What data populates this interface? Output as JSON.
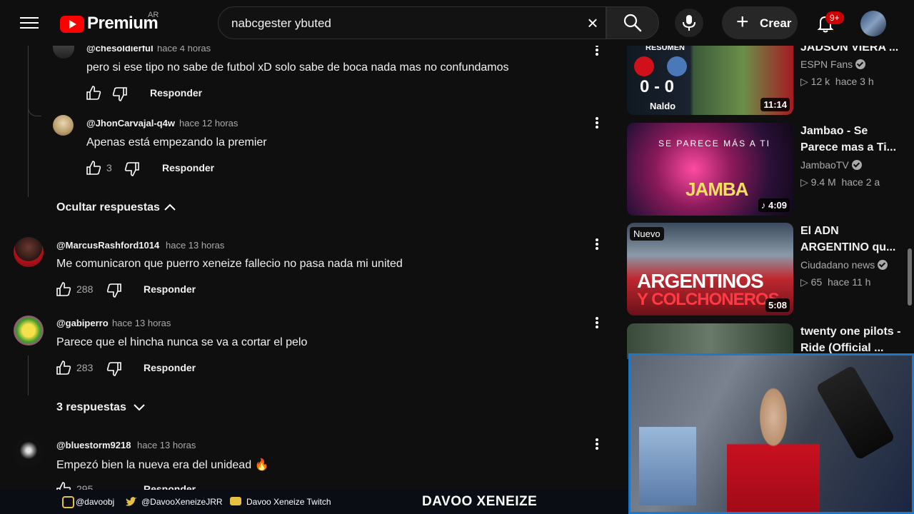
{
  "header": {
    "logo_text": "Premium",
    "country_code": "AR",
    "search_value": "nabcgester ybuted",
    "create_label": "Crear",
    "notifications_badge": "9+"
  },
  "comments": [
    {
      "author": "@chesoldierful",
      "time": "hace 4 horas",
      "text": "pero si ese tipo no sabe de futbol xD solo sabe de boca nada mas no confundamos",
      "likes": "",
      "reply": "Responder"
    },
    {
      "author": "@JhonCarvajal-q4w",
      "time": "hace 12 horas",
      "text": "Apenas está empezando la premier",
      "likes": "3",
      "reply": "Responder"
    },
    {
      "author": "@MarcusRashford1014",
      "time": "hace 13 horas",
      "text": "Me comunicaron que puerro xeneize fallecio no pasa nada mi united",
      "likes": "288",
      "reply": "Responder"
    },
    {
      "author": "@gabiperro",
      "time": "hace 13 horas",
      "text": "Parece que el hincha nunca se va a cortar el pelo",
      "likes": "283",
      "reply": "Responder"
    },
    {
      "author": "@bluestorm9218",
      "time": "hace 13 horas",
      "text": "Empezó bien la nueva era del unidead 🔥",
      "likes": "295",
      "reply": "Responder"
    }
  ],
  "toggles": {
    "hide_replies": "Ocultar respuestas",
    "show_replies": "3 respuestas"
  },
  "sidebar": {
    "videos": [
      {
        "title": "JADSON VIERA ...",
        "channel": "ESPN Fans",
        "verified": true,
        "views": "12 k",
        "age": "hace 3 h",
        "duration": "11:14",
        "thumb_text": "RESUMEN",
        "score": "0 - 0",
        "brand": "Naldo"
      },
      {
        "title": "Jambao - Se Parece mas a Ti...",
        "channel": "JambaoTV",
        "verified": true,
        "views": "9.4 M",
        "age": "hace 2 a",
        "duration": "4:09",
        "thumb_text": "SE PARECE MÁS A TI",
        "logo": "JAMBA"
      },
      {
        "title": "El ADN ARGENTINO qu...",
        "channel": "Ciudadano news",
        "verified": true,
        "views": "65",
        "age": "hace 11 h",
        "duration": "5:08",
        "badge": "Nuevo",
        "thumb_line1": "ARGENTINOS",
        "thumb_line2": "Y COLCHONEROS"
      },
      {
        "title": "twenty one pilots - Ride (Official ...",
        "channel": "",
        "verified": false,
        "views": "",
        "age": "",
        "duration": ""
      }
    ]
  },
  "overlay": {
    "instagram": "@davoobj",
    "twitter": "@DavooXeneizeJRR",
    "twitch": "Davoo Xeneize Twitch",
    "streamer_name": "DAVOO XENEIZE"
  },
  "colors": {
    "background": "#0f0f0f",
    "accent_red": "#ff0000",
    "badge_red": "#cc0000",
    "webcam_border": "#1f77c8"
  }
}
